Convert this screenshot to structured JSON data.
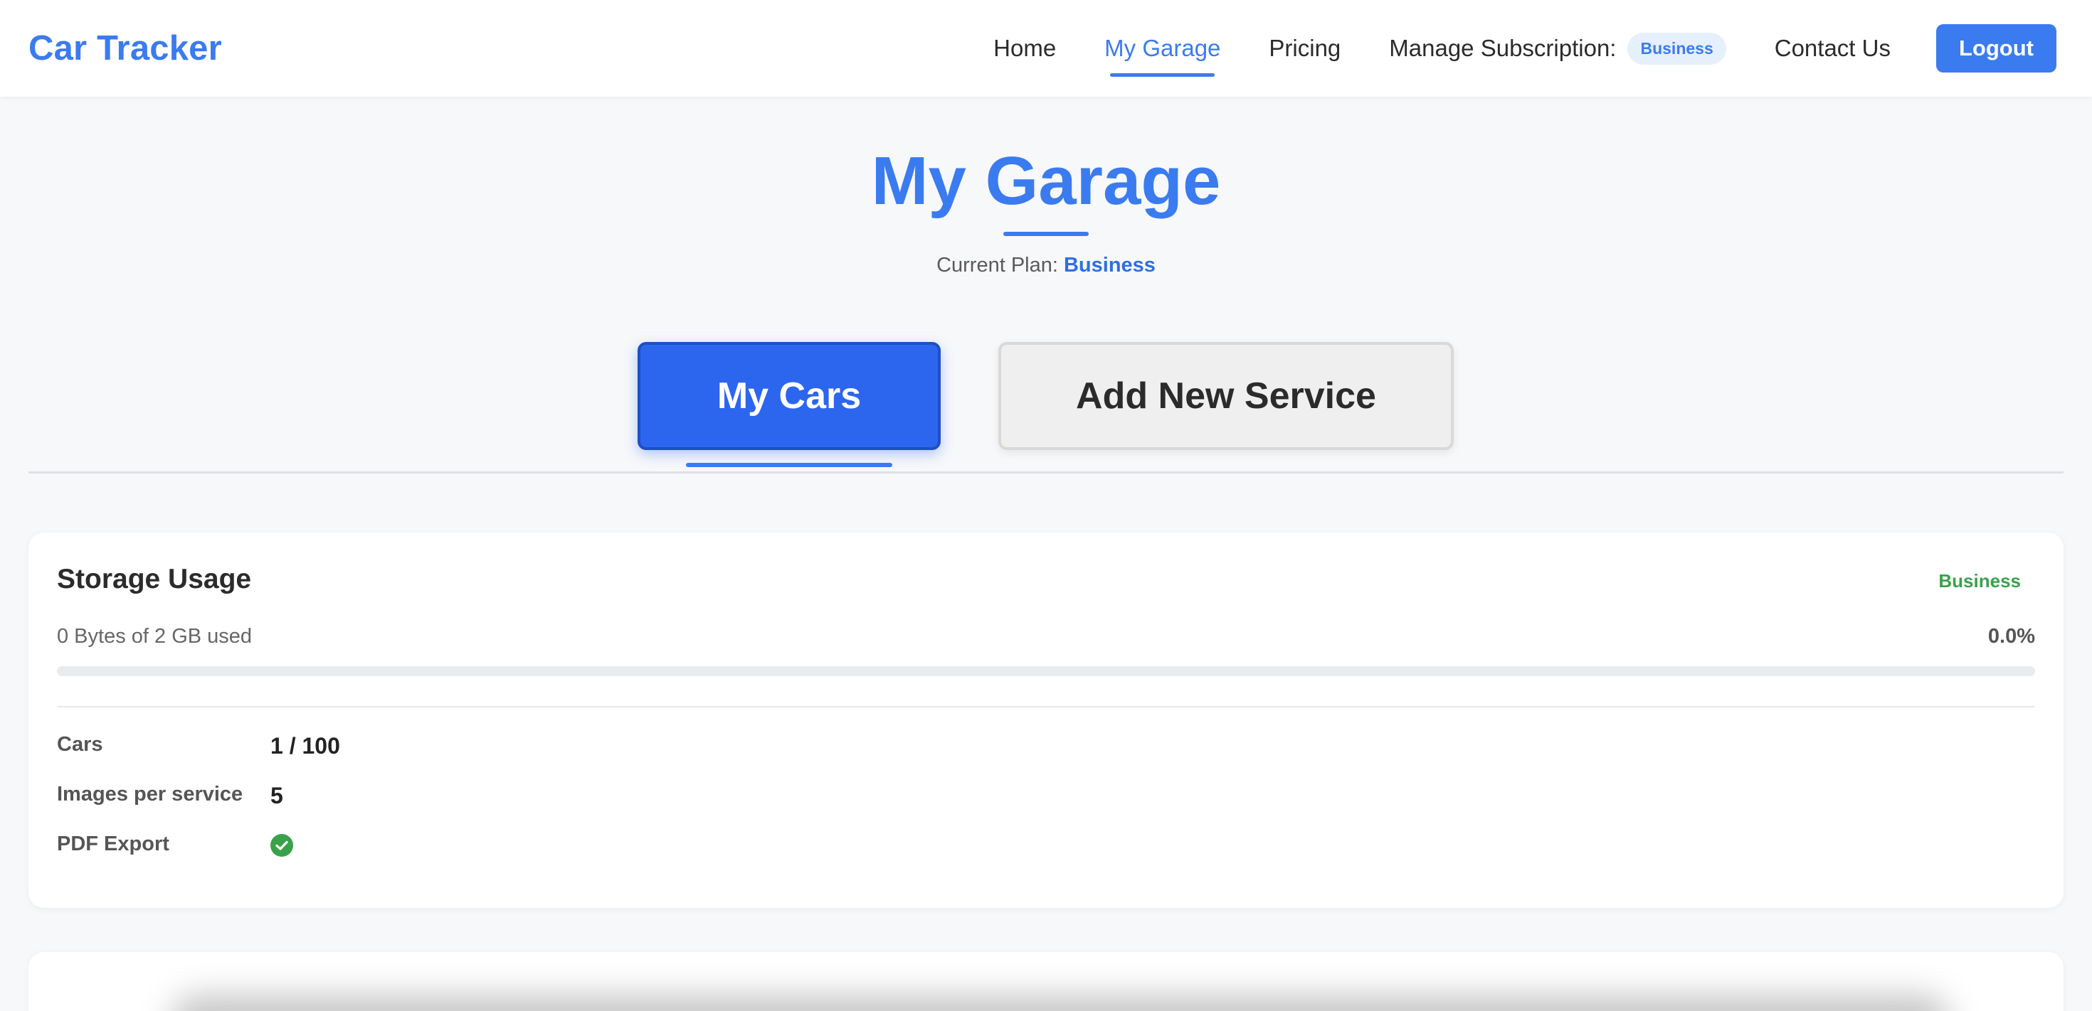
{
  "header": {
    "brand": "Car Tracker",
    "nav": {
      "home": "Home",
      "garage": "My Garage",
      "pricing": "Pricing",
      "manage": "Manage Subscription:",
      "manage_badge": "Business",
      "contact": "Contact Us"
    },
    "logout": "Logout"
  },
  "page": {
    "title": "My Garage",
    "plan_label": "Current Plan:",
    "plan_name": "Business"
  },
  "tabs": {
    "cars": "My Cars",
    "add_service": "Add New Service"
  },
  "storage": {
    "title": "Storage Usage",
    "badge": "Business",
    "usage_text": "0 Bytes of 2 GB used",
    "usage_percent": "0.0%",
    "progress_fraction": 0.0,
    "stats": {
      "cars_label": "Cars",
      "cars_value": "1 / 100",
      "images_label": "Images per service",
      "images_value": "5",
      "pdf_label": "PDF Export"
    }
  },
  "colors": {
    "accent": "#3b7bf0",
    "tab_active": "#2c66ef",
    "success": "#3aa14b"
  }
}
